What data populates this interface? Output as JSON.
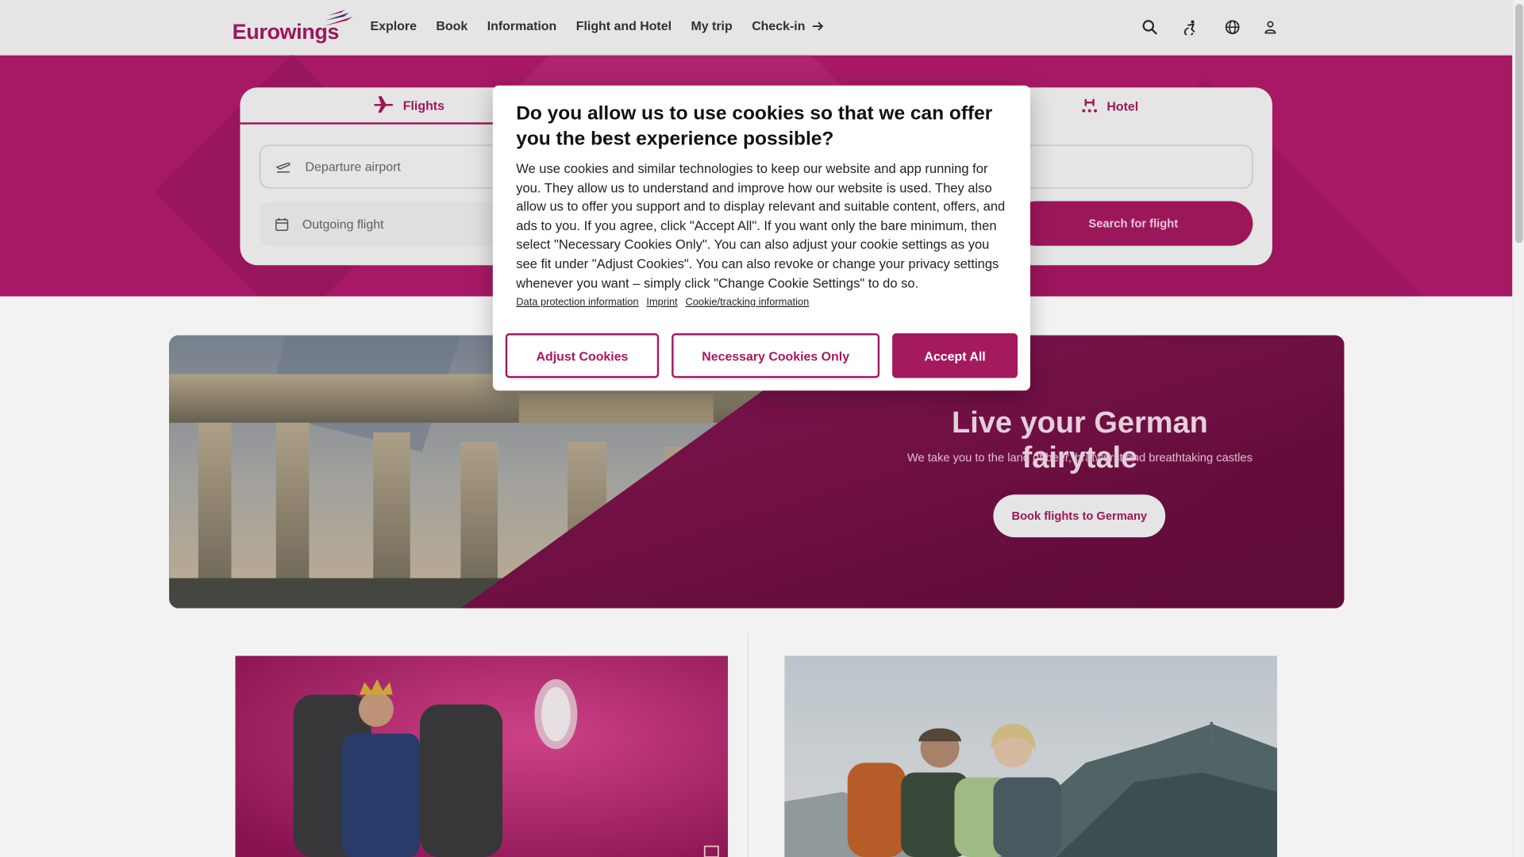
{
  "brand": {
    "name": "Eurowings",
    "accent": "#a5195f",
    "band_color": "#b01b6a"
  },
  "nav": {
    "items": [
      "Explore",
      "Book",
      "Information",
      "Flight and Hotel",
      "My trip",
      "Check-in"
    ],
    "checkin_arrow_icon": "arrow-right-icon"
  },
  "header_icons": [
    "search-icon",
    "accessibility-icon",
    "globe-icon",
    "user-icon"
  ],
  "booking": {
    "tabs": [
      {
        "label": "Flights",
        "icon": "plane-icon",
        "active": true
      },
      {
        "label": "Hotel",
        "icon": "hotel-icon",
        "active": false
      }
    ],
    "departure_placeholder": "Departure airport",
    "date_placeholder": "Outgoing flight",
    "search_button": "Search for flight"
  },
  "promo": {
    "title": "Live your German fairytale",
    "subtitle": "We take you to the land of beer, bratwurst and breathtaking castles",
    "button": "Book flights to Germany"
  },
  "cookie_dialog": {
    "title": "Do you allow us to use cookies so that we can offer you the best experience possible?",
    "body": "We use cookies and similar technologies to keep our website and app running for you. They allow us to understand and improve how our website is used. They also allow us to offer you support and to display relevant and suitable content, offers, and ads to you. If you agree, click \"Accept All\". If you want only the bare minimum, then select \"Necessary Cookies Only\". You can also adjust your cookie settings as you see fit under \"Adjust Cookies\". You can also revoke or change your privacy settings whenever you want – simply click \"Change Cookie Settings\" to do so.",
    "links": [
      "Data protection information",
      "Imprint",
      "Cookie/tracking information"
    ],
    "buttons": {
      "adjust": "Adjust Cookies",
      "necessary": "Necessary Cookies Only",
      "accept": "Accept All"
    }
  }
}
